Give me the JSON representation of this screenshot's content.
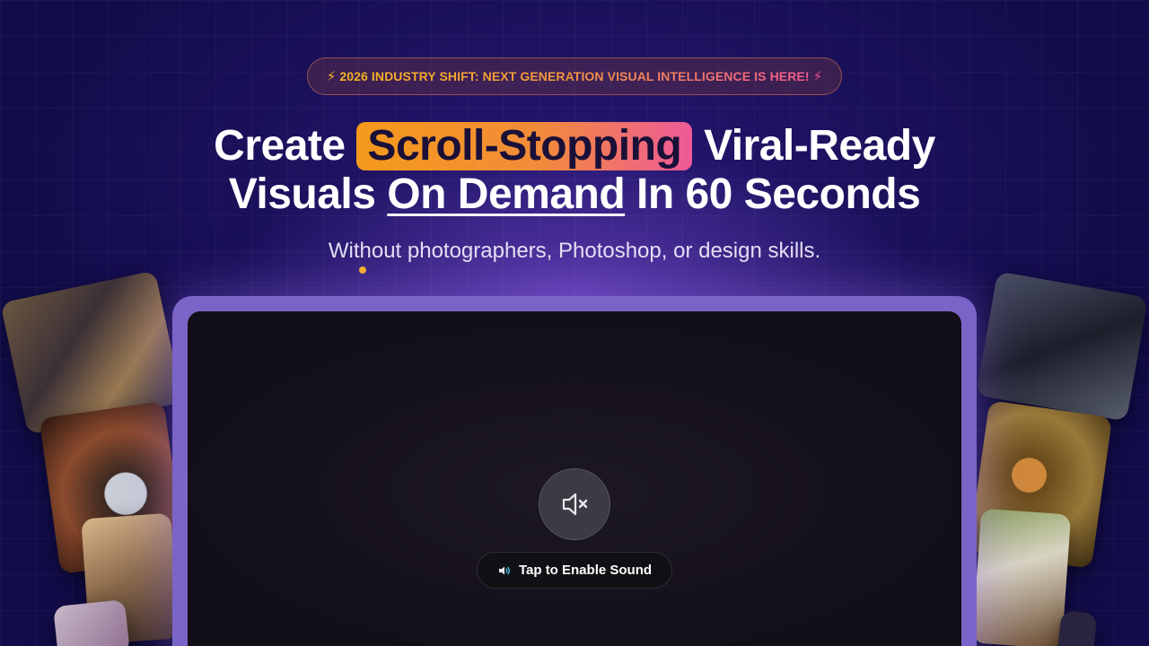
{
  "banner": {
    "text": "2026 INDUSTRY SHIFT: NEXT GENERATION VISUAL INTELLIGENCE IS HERE!",
    "left_icon": "lightning-bolt-icon",
    "right_icon": "lightning-bolt-icon"
  },
  "headline": {
    "part1": "Create ",
    "highlight": "Scroll-Stopping",
    "part2": " Viral-Ready",
    "part3": "Visuals ",
    "underlined": "On Demand",
    "part4": " In 60 Seconds"
  },
  "subheadline": "Without photographers, Photoshop, or design skills.",
  "video": {
    "mute_icon": "speaker-muted-icon",
    "sound_icon": "speaker-icon",
    "sound_label": "Tap to Enable Sound"
  },
  "colors": {
    "background": "#120c4a",
    "accent_orange": "#f59a1a",
    "accent_pink": "#ee5a9a",
    "frame": "#7b64c8"
  }
}
